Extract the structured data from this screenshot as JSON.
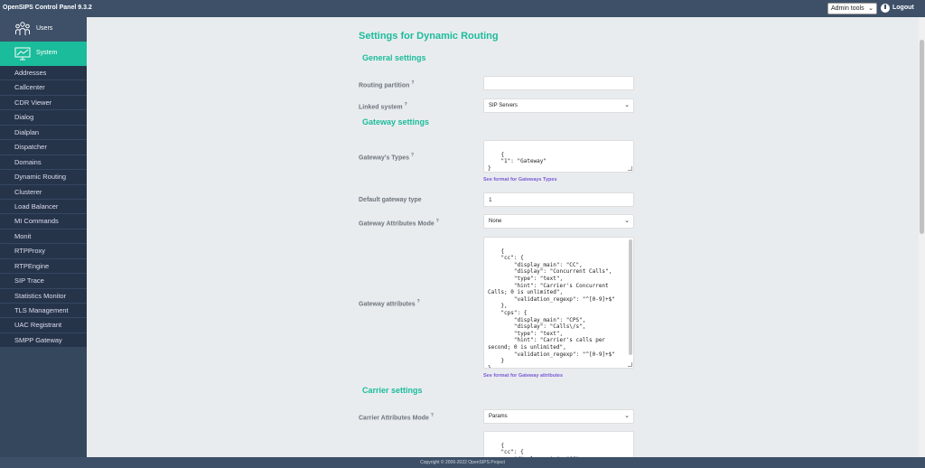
{
  "header": {
    "title": "OpenSIPS Control Panel 9.3.2",
    "admin_tools": "Admin tools",
    "logout": "Logout"
  },
  "sidebar": {
    "groups": [
      {
        "label": "Users",
        "icon": "users-icon"
      },
      {
        "label": "System",
        "icon": "system-icon"
      }
    ],
    "items": [
      "Addresses",
      "Callcenter",
      "CDR Viewer",
      "Dialog",
      "Dialplan",
      "Dispatcher",
      "Domains",
      "Dynamic Routing",
      "Clusterer",
      "Load Balancer",
      "MI Commands",
      "Monit",
      "RTPProxy",
      "RTPEngine",
      "SIP Trace",
      "Statistics Monitor",
      "TLS Management",
      "UAC Registrant",
      "SMPP Gateway"
    ]
  },
  "main": {
    "title": "Settings for Dynamic Routing",
    "sections": {
      "general": "General settings",
      "gateway": "Gateway settings",
      "carrier": "Carrier settings"
    },
    "fields": {
      "routing_partition": {
        "label": "Routing partition",
        "help": "?",
        "value": ""
      },
      "linked_system": {
        "label": "Linked system",
        "help": "?",
        "value": "SIP Servers"
      },
      "gateway_types": {
        "label": "Gateway's Types",
        "help": "?",
        "value": "{\n    \"1\": \"Gateway\"\n}",
        "link": "See format for Gateways Types"
      },
      "default_gateway_type": {
        "label": "Default gateway type",
        "value": "1"
      },
      "gateway_attributes_mode": {
        "label": "Gateway Attributes Mode",
        "help": "?",
        "value": "None"
      },
      "gateway_attributes": {
        "label": "Gateway attributes",
        "help": "?",
        "value": "{\n    \"cc\": {\n        \"display_main\": \"CC\",\n        \"display\": \"Concurrent Calls\",\n        \"type\": \"text\",\n        \"hint\": \"Carrier's Concurrent\nCalls; 0 is unlimited\",\n        \"validation_regexp\": \"^[0-9]+$\"\n    },\n    \"cps\": {\n        \"display_main\": \"CPS\",\n        \"display\": \"Calls\\/s\",\n        \"type\": \"text\",\n        \"hint\": \"Carrier's calls per\nsecond; 0 is unlimited\",\n        \"validation_regexp\": \"^[0-9]+$\"\n    }\n}",
        "link": "See format for Gateway attributes"
      },
      "carrier_attributes_mode": {
        "label": "Carrier Attributes Mode",
        "help": "?",
        "value": "Params"
      },
      "carrier_attributes": {
        "value": "{\n    \"cc\": {\n        \"display_main\": \"CC\","
      }
    }
  },
  "footer": "Copyright © 2006-2022 OpenSIPS Project"
}
